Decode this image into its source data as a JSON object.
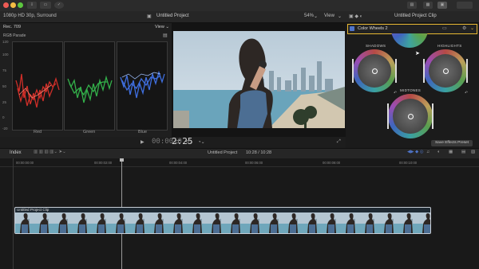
{
  "titlebar": {
    "buttons": [
      "⇩",
      "▭",
      "✓"
    ],
    "window_title": "Untitled Project",
    "right_buttons": [
      "▤",
      "▦",
      "▣"
    ]
  },
  "infobar": {
    "format": "1080p HD 30p, Surround",
    "project_title": "Untitled Project",
    "zoom": "54%",
    "view_label": "View",
    "inspector_title": "Untitled Project Clip"
  },
  "scopes": {
    "mode": "Rec. 709",
    "view_label": "View",
    "name": "RGB Parade",
    "scale": [
      "120",
      "100",
      "75",
      "50",
      "25",
      "0",
      "-20"
    ],
    "channels": [
      "Red",
      "Green",
      "Blue"
    ]
  },
  "inspector": {
    "effect": "Color Wheels 2",
    "wheels": {
      "shadows": "SHADOWS",
      "highlights": "HIGHLIGHTS",
      "midtones": "MIDTONES"
    },
    "save_preset": "Save Effects Preset"
  },
  "playback": {
    "timecode": "2:25"
  },
  "timeline": {
    "index_label": "Index",
    "project_title": "Untitled Project",
    "duration": "10:28 / 10:28",
    "ticks": [
      "00:00:00:00",
      "00:00:02:00",
      "00:00:04:00",
      "00:00:06:00",
      "00:00:08:00",
      "00:00:10:00"
    ],
    "clip_name": "Untitled Project Clip"
  },
  "colors": {
    "accent": "#e8b832",
    "selected_clip_border": "#c8ced6",
    "inspector_blue": "#4f74c9"
  }
}
